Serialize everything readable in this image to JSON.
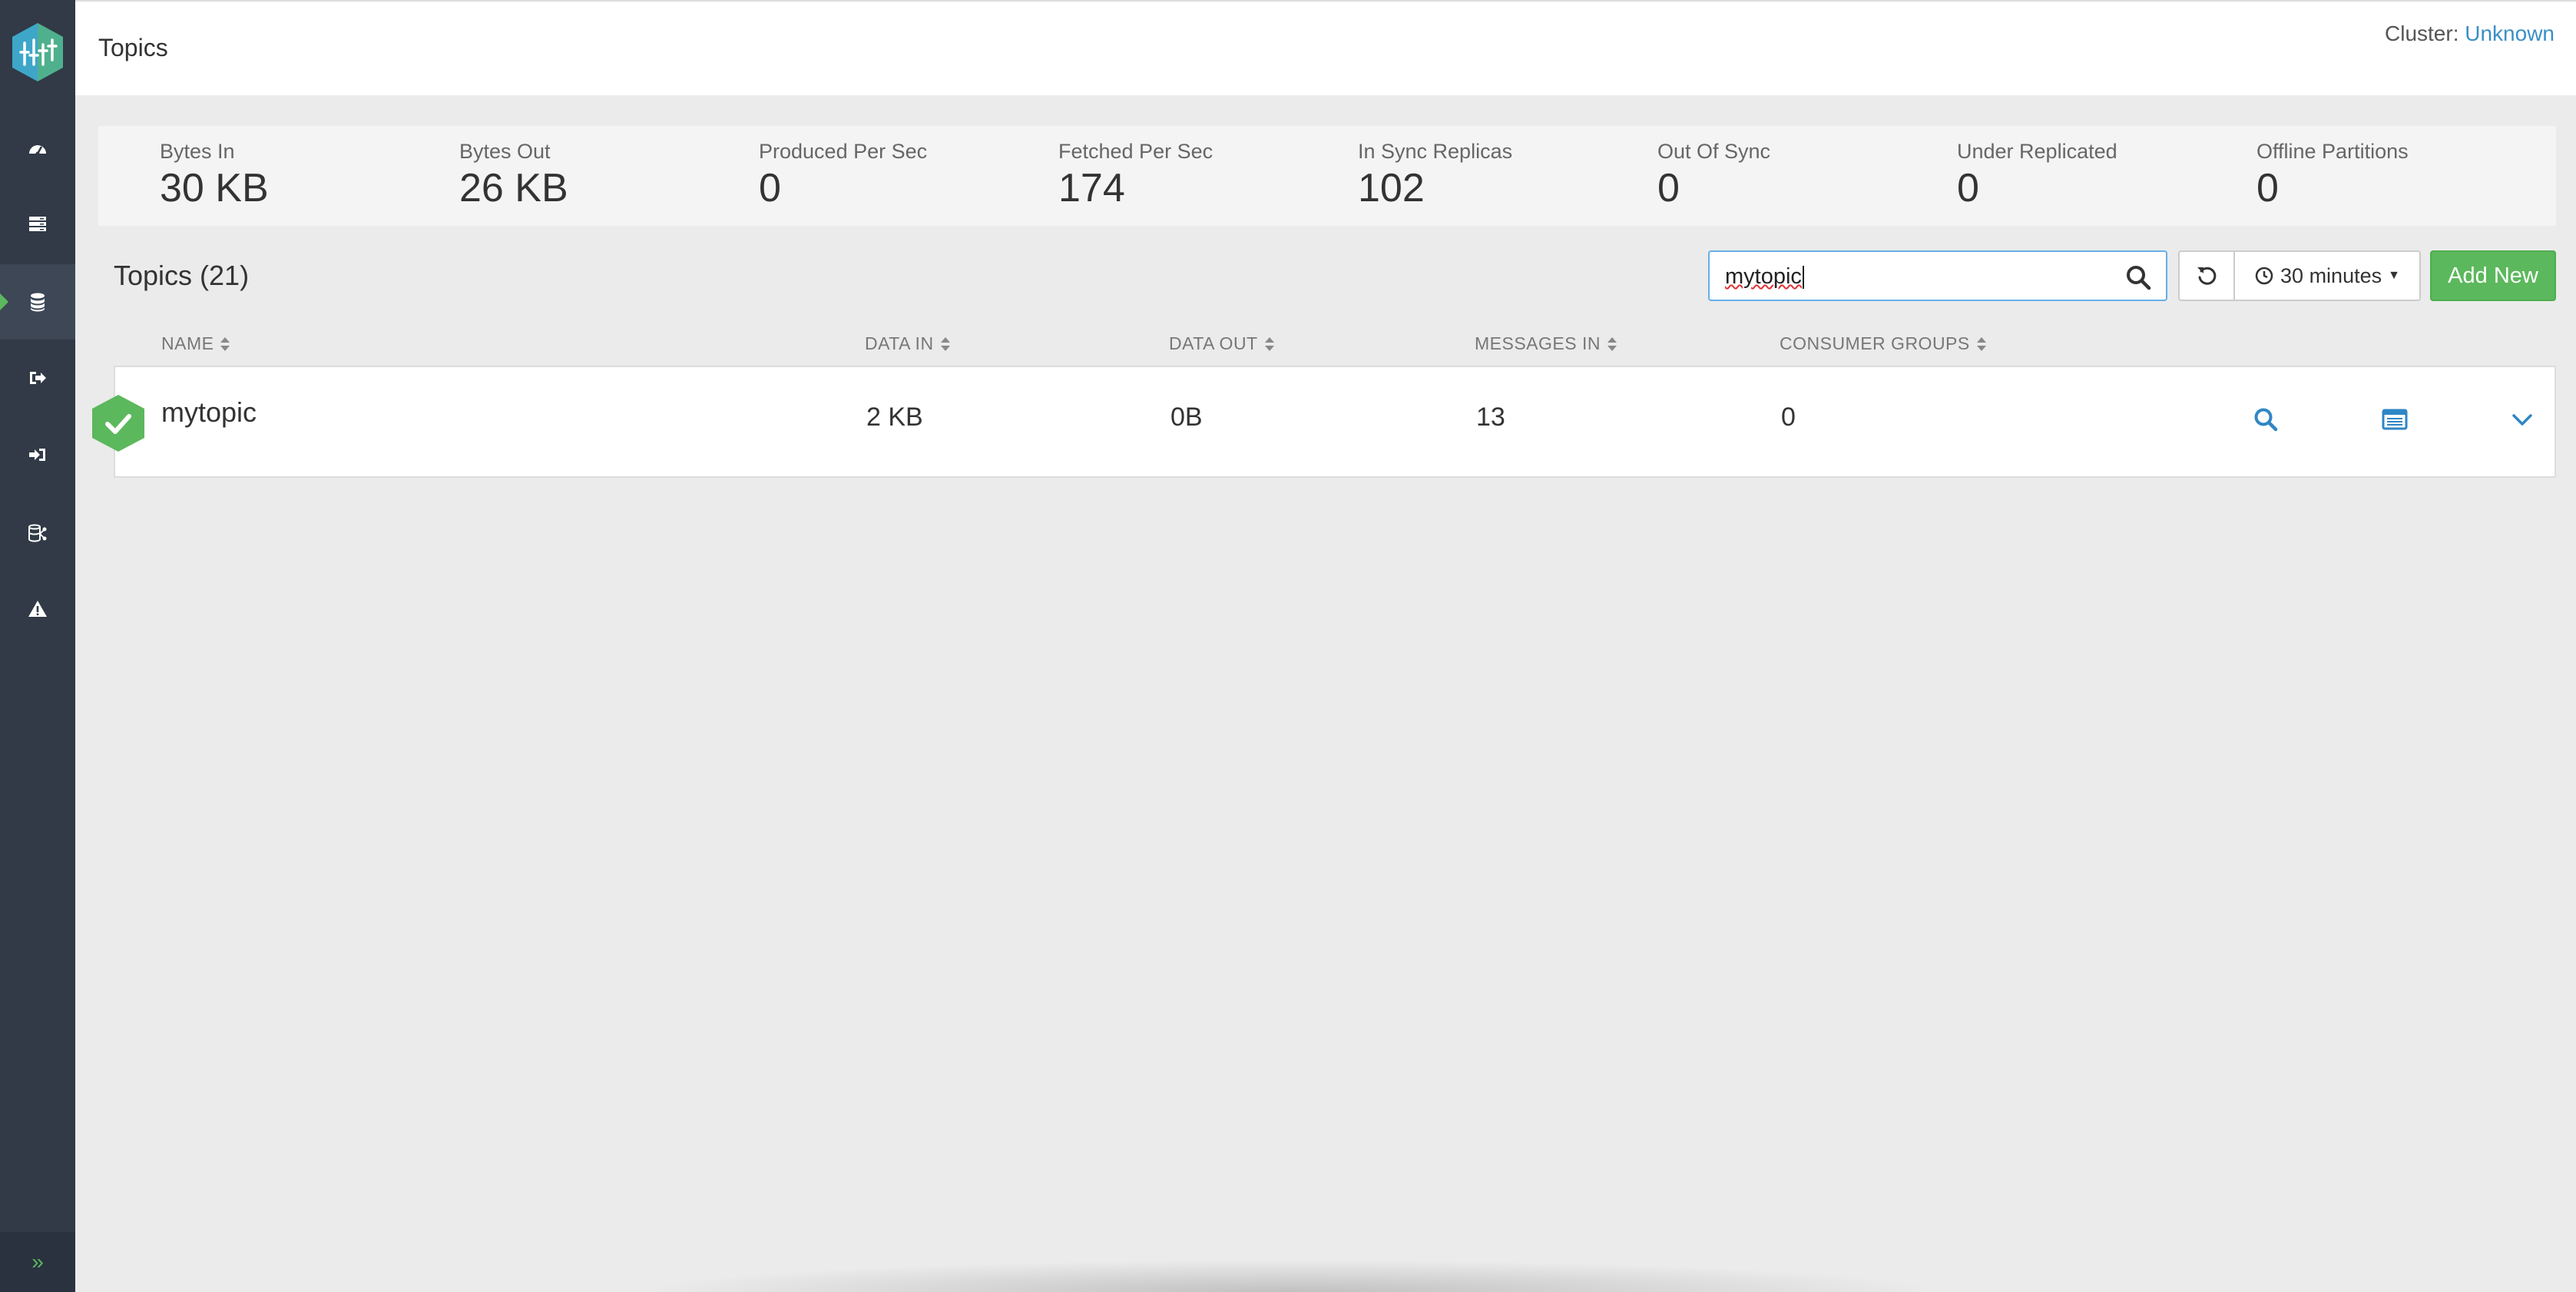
{
  "app": {
    "logo": "kafka-logo",
    "page_title": "Topics"
  },
  "cluster": {
    "label": "Cluster:",
    "value": "Unknown",
    "link_color": "#3a8fc7"
  },
  "sidebar": {
    "items": [
      {
        "icon": "dashboard-icon"
      },
      {
        "icon": "brokers-icon"
      },
      {
        "icon": "topics-icon",
        "active": true
      },
      {
        "icon": "producers-icon"
      },
      {
        "icon": "consumers-icon"
      },
      {
        "icon": "connect-icon"
      },
      {
        "icon": "alerts-icon"
      }
    ],
    "expand_icon": "double-chevron-right-icon"
  },
  "stats": [
    {
      "label": "Bytes In",
      "value": "30 KB"
    },
    {
      "label": "Bytes Out",
      "value": "26 KB"
    },
    {
      "label": "Produced Per Sec",
      "value": "0"
    },
    {
      "label": "Fetched Per Sec",
      "value": "174"
    },
    {
      "label": "In Sync Replicas",
      "value": "102"
    },
    {
      "label": "Out Of Sync",
      "value": "0"
    },
    {
      "label": "Under Replicated",
      "value": "0"
    },
    {
      "label": "Offline Partitions",
      "value": "0"
    }
  ],
  "topics": {
    "title": "Topics (21)",
    "search": {
      "value": "mytopic",
      "icon": "search-icon"
    },
    "refresh_icon": "refresh-icon",
    "time_range": {
      "label": "30 minutes",
      "icon": "clock-icon"
    },
    "add_label": "Add New",
    "columns": [
      "NAME",
      "DATA IN",
      "DATA OUT",
      "MESSAGES IN",
      "CONSUMER GROUPS"
    ],
    "rows": [
      {
        "status": "healthy",
        "name": "mytopic",
        "data_in": "2 KB",
        "data_out": "0B",
        "messages_in": "13",
        "consumer_groups": "0"
      }
    ]
  },
  "colors": {
    "sidebar": "#313a46",
    "accent": "#5cb85c",
    "link": "#3a8fc7",
    "background": "#ebebeb"
  }
}
